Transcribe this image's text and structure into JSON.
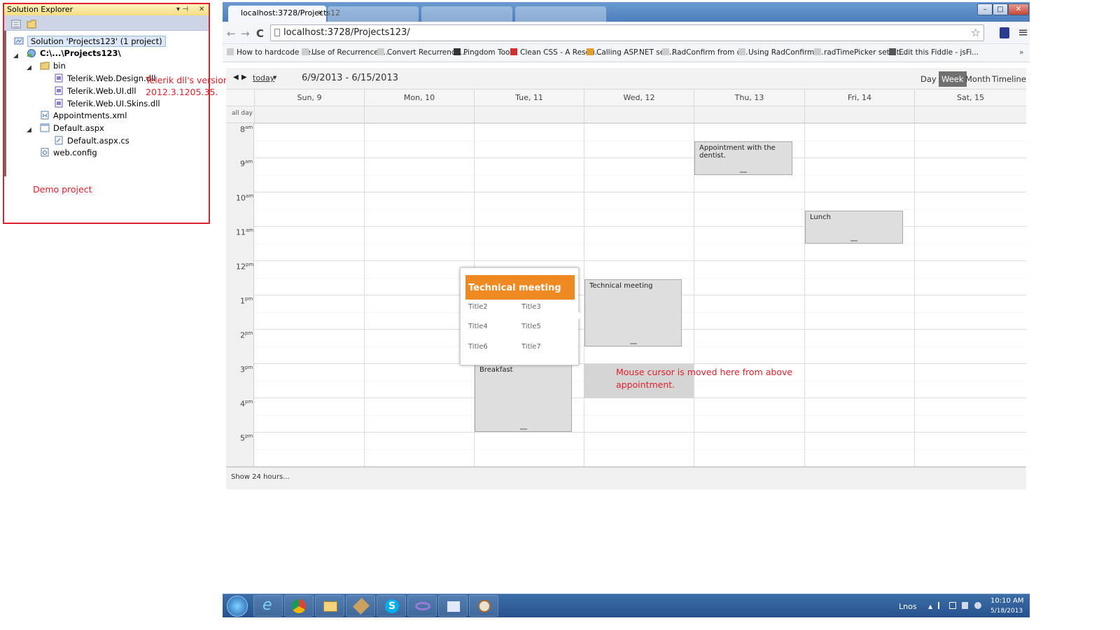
{
  "solution_explorer": {
    "title": "Solution Explorer",
    "pin_glyph": "▾ ⊣",
    "close_glyph": "✕",
    "solution": "Solution 'Projects123' (1 project)",
    "project": "C:\\...\\Projects123\\",
    "folder_bin": "bin",
    "files_bin": [
      "Telerik.Web.Design.dll",
      "Telerik.Web.UI.dll",
      "Telerik.Web.UI.Skins.dll"
    ],
    "appointments": "Appointments.xml",
    "default_aspx": "Default.aspx",
    "default_cs": "Default.aspx.cs",
    "web_config": "web.config",
    "expand_glyph": "◢"
  },
  "notes": {
    "dll_version_line1": "Telerik dll's version is",
    "dll_version_line2": "2012.3.1205.35.",
    "demo": "Demo project",
    "mouse_line1": "Mouse cursor is moved here from above",
    "mouse_line2": "appointment."
  },
  "browser": {
    "active_tab": "localhost:3728/Projects12",
    "tab_close": "✕",
    "url": "localhost:3728/Projects123/",
    "back_glyph": "←",
    "forward_glyph": "→",
    "reload_glyph": "C",
    "star_glyph": "☆",
    "menu_glyph": "≡",
    "overflow_glyph": "»",
    "win_min": "–",
    "win_max": "□",
    "win_close": "✕",
    "bookmarks": [
      "How to hardcode Re...",
      "Use of RecurrenceR...",
      "Convert Recurrence...",
      "Pingdom Tools",
      "Clean CSS - A Resou...",
      "Calling ASP.NET ser...",
      "RadConfirm from c...",
      "Using RadConfirm ...",
      "radTimePicker set St...",
      "Edit this Fiddle - jsFi..."
    ]
  },
  "scheduler": {
    "prev_glyph": "◀",
    "next_glyph": "▶",
    "today": "today",
    "today_caret": "▼",
    "range": "6/9/2013 - 6/15/2013",
    "views": [
      "Day",
      "Week",
      "Month",
      "Timeline"
    ],
    "active_view": "Week",
    "days": [
      "Sun, 9",
      "Mon, 10",
      "Tue, 11",
      "Wed, 12",
      "Thu, 13",
      "Fri, 14",
      "Sat, 15"
    ],
    "all_day": "all day",
    "hours": [
      {
        "n": "8",
        "ap": "am"
      },
      {
        "n": "9",
        "ap": "am"
      },
      {
        "n": "10",
        "ap": "am"
      },
      {
        "n": "11",
        "ap": "am"
      },
      {
        "n": "12",
        "ap": "pm"
      },
      {
        "n": "1",
        "ap": "pm"
      },
      {
        "n": "2",
        "ap": "pm"
      },
      {
        "n": "3",
        "ap": "pm"
      },
      {
        "n": "4",
        "ap": "pm"
      },
      {
        "n": "5",
        "ap": "pm"
      }
    ],
    "appointments": {
      "dentist": "Appointment with the dentist.",
      "lunch": "Lunch",
      "technical": "Technical meeting",
      "breakfast": "Breakfast"
    },
    "tooltip": {
      "title": "Technical meeting",
      "cells": [
        "Title2",
        "Title3",
        "Title4",
        "Title5",
        "Title6",
        "Title7"
      ]
    },
    "show_hours": "Show 24 hours..."
  },
  "taskbar": {
    "lang": "Lnos",
    "arrow": "▲",
    "time": "10:10 AM",
    "date": "5/18/2013",
    "ie_glyph": "e",
    "skype_glyph": "S"
  }
}
